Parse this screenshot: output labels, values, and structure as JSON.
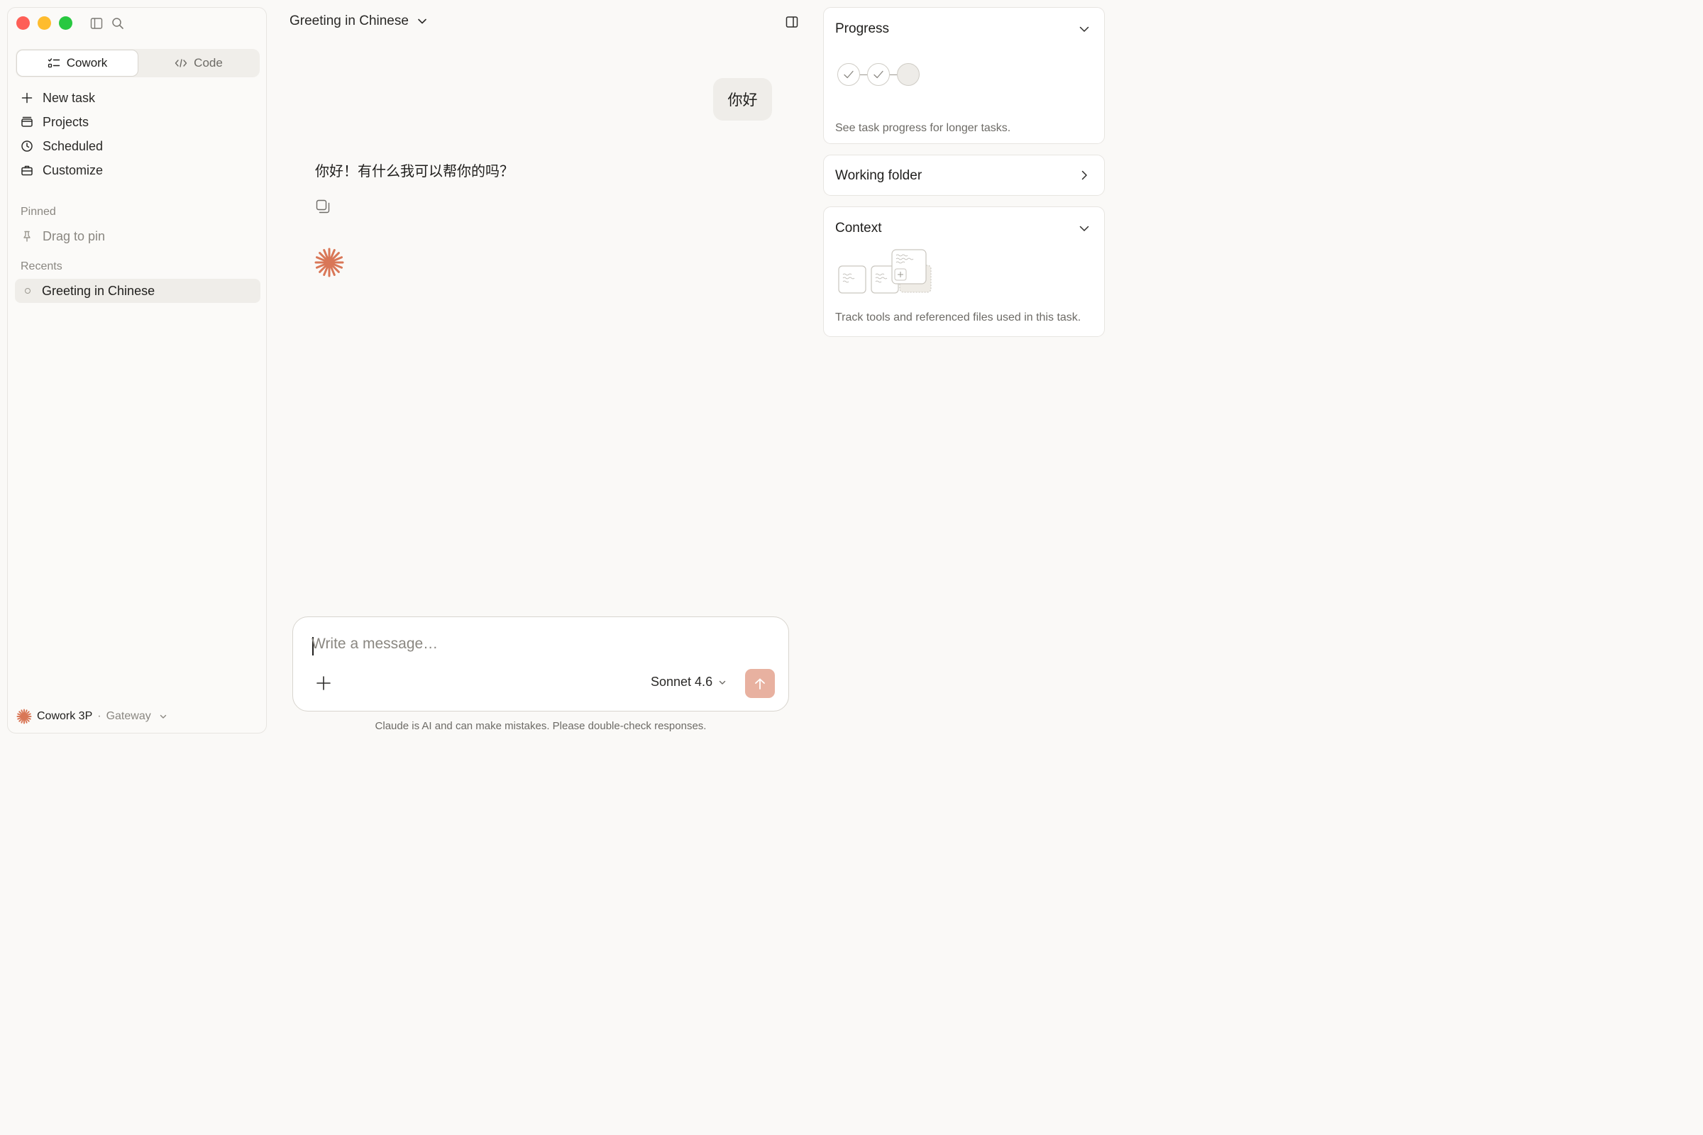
{
  "sidebar": {
    "mode_cowork": "Cowork",
    "mode_code": "Code",
    "nav": {
      "new_task": "New task",
      "projects": "Projects",
      "scheduled": "Scheduled",
      "customize": "Customize"
    },
    "pinned_label": "Pinned",
    "pin_hint": "Drag to pin",
    "recents_label": "Recents",
    "recent_item": "Greeting in Chinese",
    "footer": {
      "app": "Cowork 3P",
      "separator": "·",
      "gateway": "Gateway"
    }
  },
  "header": {
    "title": "Greeting in Chinese"
  },
  "conversation": {
    "user_message": "你好",
    "assistant_message": "你好！有什么我可以帮你的吗？"
  },
  "composer": {
    "placeholder": "Write a message…",
    "model": "Sonnet 4.6",
    "disclaimer": "Claude is AI and can make mistakes. Please double-check responses."
  },
  "panel": {
    "progress": {
      "title": "Progress",
      "description": "See task progress for longer tasks.",
      "steps": [
        "done",
        "done",
        "pending"
      ]
    },
    "working_folder": {
      "title": "Working folder"
    },
    "context": {
      "title": "Context",
      "description": "Track tools and referenced files used in this task."
    }
  },
  "colors": {
    "accent": "#d97757",
    "send_button": "#e8b1a0",
    "background": "#faf9f7"
  },
  "icons": {
    "new_task": "plus-icon",
    "projects": "folder-icon",
    "scheduled": "clock-icon",
    "customize": "briefcase-icon",
    "pin": "pin-icon"
  }
}
